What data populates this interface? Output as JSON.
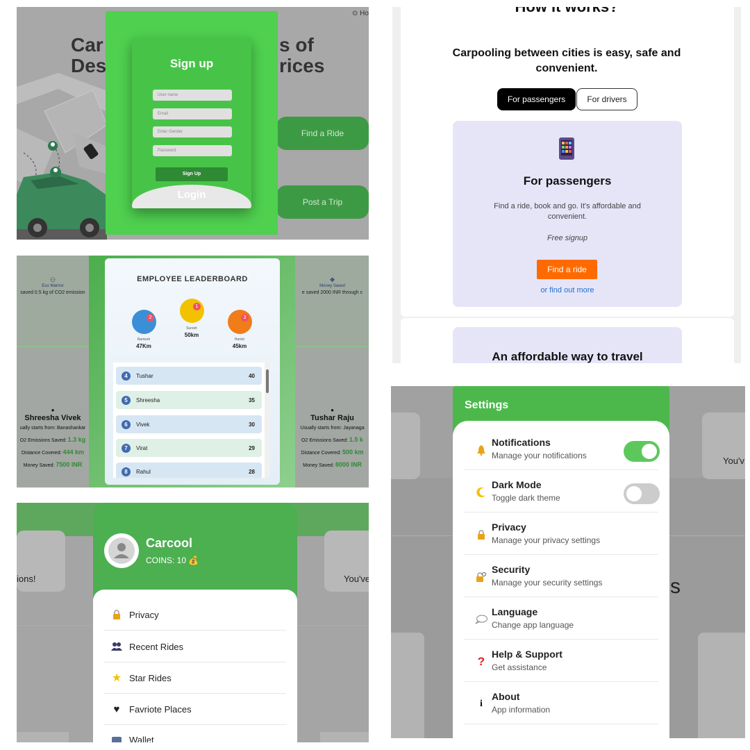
{
  "signup": {
    "bg_heading_left": "Car\nDest",
    "bg_heading_right": "s of\nrices",
    "help_text": "⊙ Ho",
    "title": "Sign up",
    "fields": {
      "username": "User name",
      "email": "Email",
      "gender": "Enter Gender",
      "password": "Password"
    },
    "signup_button": "Sign Up",
    "login_label": "Login",
    "find_ride": "Find a Ride",
    "post_trip": "Post a Trip",
    "accent": "#4fd04f"
  },
  "how": {
    "title_partial": "How it works?",
    "heading": "Carpooling between cities is easy, safe and convenient.",
    "tabs": [
      "For passengers",
      "For drivers"
    ],
    "card_icon": "phone-app-icon",
    "card_title": "For passengers",
    "card_desc": "Find a ride, book and go. It's affordable and convenient.",
    "card_note": "Free signup",
    "cta": "Find a ride",
    "more_link": "or find out more",
    "second_card_title": "An affordable way to travel",
    "accent": "#ff6a00"
  },
  "leaderboard": {
    "title": "EMPLOYEE LEADERBOARD",
    "bg_left_title": "Eco Warrior",
    "bg_left_sub": "saved 0.5 kg of CO2 emission",
    "bg_right_title": "Money Saved",
    "bg_right_sub": "e saved 2000 INR through c",
    "top": [
      {
        "rank": "2",
        "name": "Ramesh",
        "value": "47Km"
      },
      {
        "rank": "1",
        "name": "Suresh",
        "value": "50km"
      },
      {
        "rank": "3",
        "name": "Harish",
        "value": "45km"
      }
    ],
    "rows": [
      {
        "rank": "4",
        "name": "Tushar",
        "points": "40"
      },
      {
        "rank": "5",
        "name": "Shreesha",
        "points": "35"
      },
      {
        "rank": "6",
        "name": "Vivek",
        "points": "30"
      },
      {
        "rank": "7",
        "name": "Virat",
        "points": "29"
      },
      {
        "rank": "8",
        "name": "Rahul",
        "points": "28"
      }
    ],
    "bg_left_person": {
      "name": "Shreesha Vivek",
      "starts": "ually starts from: Banashankar",
      "co2_label": "O2 Emissions Saved:",
      "co2": "1.3 kg",
      "dist_label": "Distance Covered:",
      "dist": "444 km",
      "money_label": "Money Saved:",
      "money": "7500 INR"
    },
    "bg_right_person": {
      "name": "Tushar Raju",
      "starts": "Usually starts from: Jayanaga",
      "co2_label": "O2 Emissions Saved:",
      "co2": "1.5 k",
      "dist_label": "Distance Covered:",
      "dist": "500 km",
      "money_label": "Money Saved:",
      "money": "8000 INR"
    }
  },
  "profile": {
    "name": "Carcool",
    "coins": "COINS: 10",
    "bg_left": "ions!",
    "bg_right": "You've",
    "items": [
      {
        "icon": "lock-icon",
        "label": "Privacy"
      },
      {
        "icon": "people-icon",
        "label": "Recent Rides"
      },
      {
        "icon": "star-icon",
        "label": "Star Rides"
      },
      {
        "icon": "heart-icon",
        "label": "Favriote Places"
      },
      {
        "icon": "wallet-icon",
        "label": "Wallet"
      }
    ]
  },
  "settings": {
    "title": "Settings",
    "bg_right": "You'v",
    "bg_letter": "s",
    "items": [
      {
        "icon": "bell-icon",
        "title": "Notifications",
        "sub": "Manage your notifications",
        "toggle": true
      },
      {
        "icon": "moon-icon",
        "title": "Dark Mode",
        "sub": "Toggle dark theme",
        "toggle": false
      },
      {
        "icon": "lock-icon",
        "title": "Privacy",
        "sub": "Manage your privacy settings"
      },
      {
        "icon": "key-lock-icon",
        "title": "Security",
        "sub": "Manage your security settings"
      },
      {
        "icon": "speech-bubble-icon",
        "title": "Language",
        "sub": "Change app language"
      },
      {
        "icon": "question-icon",
        "title": "Help & Support",
        "sub": "Get assistance"
      },
      {
        "icon": "info-icon",
        "title": "About",
        "sub": "App information"
      }
    ],
    "accent": "#4cb84c"
  }
}
